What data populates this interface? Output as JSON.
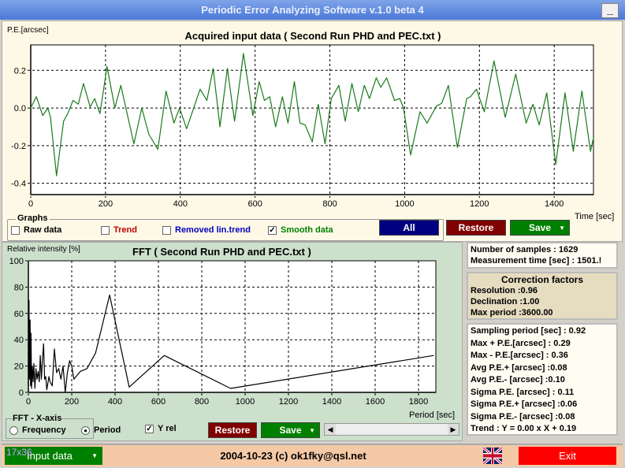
{
  "window": {
    "title": "Periodic Error Analyzing Software v.1.0 beta 4",
    "minimize": "_"
  },
  "top_chart": {
    "ylabel": "P.E.[arcsec]",
    "title": "Acquired input data ( Second Run PHD and PEC.txt )",
    "xlabel": "Time [sec]"
  },
  "graphs": {
    "legend": "Graphs",
    "items": [
      {
        "label": "Raw data",
        "checked": false,
        "color": "#000000"
      },
      {
        "label": "Trend",
        "checked": false,
        "color": "#c00000"
      },
      {
        "label": "Removed lin.trend",
        "checked": false,
        "color": "#0000c0"
      },
      {
        "label": "Smooth data",
        "checked": true,
        "color": "#008000"
      }
    ],
    "all": "All",
    "restore": "Restore",
    "save": "Save"
  },
  "fft_chart": {
    "ylabel": "Relative intensity [%]",
    "title": "FFT ( Second Run PHD and PEC.txt )",
    "xlabel": "Period [sec]"
  },
  "fft_controls": {
    "legend": "FFT - X-axis",
    "frequency": "Frequency",
    "period": "Period",
    "selected": "Period",
    "yrel": "Y rel",
    "yrel_checked": true,
    "restore": "Restore",
    "save": "Save"
  },
  "stats": {
    "samples": "Number of samples : 1629",
    "mtime": "Measurement time [sec] : 1501.!"
  },
  "correction": {
    "title": "Correction factors",
    "resolution": "Resolution :0.96",
    "declination": "Declination :1.00",
    "max_period": "Max period :3600.00"
  },
  "results": [
    "Sampling period [sec] : 0.92",
    "Max + P.E.[arcsec] : 0.29",
    "Max - P.E.[arcsec] : 0.36",
    "Avg P.E.+ [arcsec] :0.08",
    "Avg P.E.- [arcsec] :0.10",
    "Sigma P.E. [arcsec] : 0.11",
    "Sigma P.E.+ [arcsec] :0.06",
    "Sigma P.E.- [arcsec] :0.08",
    "Trend : Y = 0.00 x X + 0.19"
  ],
  "bottom": {
    "overlay": "17x36",
    "mode": "Input data",
    "credit": "2004-10-23 (c) ok1fky@qsl.net",
    "exit": "Exit"
  },
  "colors": {
    "curve": "#1a7a1a",
    "all": "#000080",
    "restore": "#800000",
    "save": "#008000",
    "exit": "#ff0000",
    "mode": "#008000"
  },
  "chart_data": [
    {
      "type": "line",
      "title": "Acquired input data ( Second Run PHD and PEC.txt )",
      "xlabel": "Time [sec]",
      "ylabel": "P.E.[arcsec]",
      "xlim": [
        0,
        1505
      ],
      "ylim": [
        -0.46,
        0.335
      ],
      "xticks": [
        0,
        200,
        400,
        600,
        800,
        1000,
        1200,
        1400
      ],
      "yticks": [
        -0.4,
        -0.2,
        0.0,
        0.2
      ],
      "ytick_labels": [
        "-0.4",
        "-0.2",
        "0.0",
        "0.2"
      ],
      "grid": true,
      "x": [
        0,
        15,
        32,
        46,
        53,
        69,
        88,
        99,
        113,
        127,
        141,
        159,
        171,
        185,
        204,
        225,
        241,
        276,
        297,
        316,
        340,
        362,
        383,
        398,
        417,
        453,
        471,
        488,
        506,
        526,
        545,
        569,
        594,
        611,
        625,
        639,
        655,
        673,
        688,
        705,
        720,
        734,
        753,
        769,
        787,
        804,
        824,
        841,
        859,
        876,
        892,
        906,
        924,
        936,
        952,
        973,
        987,
        997,
        1016,
        1041,
        1060,
        1085,
        1099,
        1117,
        1141,
        1166,
        1176,
        1192,
        1213,
        1239,
        1269,
        1297,
        1325,
        1343,
        1360,
        1380,
        1404,
        1429,
        1451,
        1474,
        1497,
        1505
      ],
      "y": [
        0,
        0.06,
        -0.04,
        0,
        -0.05,
        -0.36,
        -0.07,
        -0.03,
        0.04,
        0.02,
        0.13,
        0.005,
        0.05,
        -0.03,
        0.22,
        0,
        0.12,
        -0.19,
        0,
        -0.14,
        -0.22,
        0.09,
        -0.08,
        0,
        -0.11,
        0.1,
        0.04,
        0.21,
        -0.1,
        0.21,
        -0.07,
        0.29,
        -0.04,
        0.14,
        0.04,
        0.06,
        -0.1,
        0.06,
        -0.08,
        0.14,
        -0.08,
        -0.09,
        -0.18,
        0.02,
        -0.19,
        0.05,
        0.12,
        -0.07,
        0.13,
        -0.02,
        0.12,
        0.05,
        0.16,
        0.11,
        0.16,
        0.04,
        0.05,
        0,
        -0.25,
        -0.02,
        -0.08,
        0.01,
        0.025,
        0.12,
        -0.21,
        0.05,
        0.06,
        0.1,
        -0.02,
        0.25,
        -0.05,
        0.18,
        -0.08,
        0.02,
        -0.09,
        0.08,
        -0.3,
        0.08,
        -0.23,
        0.09,
        -0.23,
        -0.16
      ]
    },
    {
      "type": "line",
      "title": "FFT ( Second Run PHD and PEC.txt )",
      "xlabel": "Period [sec]",
      "ylabel": "Relative intensity [%]",
      "xlim": [
        0,
        1880
      ],
      "ylim": [
        0,
        100
      ],
      "xticks": [
        0,
        200,
        400,
        600,
        800,
        1000,
        1200,
        1400,
        1600,
        1800
      ],
      "yticks": [
        0,
        20,
        40,
        60,
        80,
        100
      ],
      "grid": true,
      "x": [
        0,
        3,
        5,
        8,
        10,
        12,
        15,
        18,
        22,
        25,
        30,
        35,
        40,
        45,
        50,
        55,
        60,
        65,
        70,
        75,
        80,
        85,
        95,
        100,
        110,
        120,
        130,
        140,
        150,
        160,
        170,
        180,
        190,
        200,
        210,
        240,
        270,
        310,
        375,
        465,
        627,
        933,
        1870
      ],
      "y": [
        5,
        70,
        10,
        55,
        5,
        45,
        3,
        20,
        8,
        22,
        3,
        18,
        10,
        16,
        8,
        28,
        10,
        25,
        37,
        10,
        12,
        2,
        12,
        8,
        5,
        33,
        15,
        18,
        10,
        20,
        0,
        15,
        24,
        20,
        10,
        16,
        18,
        30,
        74,
        4,
        28,
        3,
        28
      ]
    }
  ]
}
